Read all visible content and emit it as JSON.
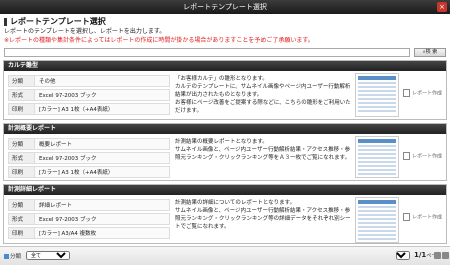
{
  "window": {
    "title": "レポートテンプレート選択",
    "close_glyph": "×"
  },
  "header": {
    "title": "レポートテンプレート選択",
    "description": "レポートのテンプレートを選択し、レポートを出力します。",
    "warning": "※レポートの種類や集計条件によってはレポートの作成に時間が掛かる場合がありますことを予めご了承願います。"
  },
  "search": {
    "placeholder": "",
    "button_label": "検 索"
  },
  "cards": [
    {
      "title": "カルテ雛型",
      "attrs": [
        {
          "key": "分類",
          "value": "その他"
        },
        {
          "key": "形式",
          "value": "Excel 97-2003 ブック"
        },
        {
          "key": "印刷",
          "value": "[カラー] A3 1枚（+A4表紙）"
        }
      ],
      "description": "「お客様カルテ」の雛形となります。\nカルテのテンプレートに、サムネイル画像やページ内ユーザー行動解析結果が出力されたものとなります。\nお客様にページ改善をご提案する際などに、こちらの雛形をご利用いただけます。",
      "make_label": "レポート作成"
    },
    {
      "title": "計測概要レポート",
      "attrs": [
        {
          "key": "分類",
          "value": "概要レポート"
        },
        {
          "key": "形式",
          "value": "Excel 97-2003 ブック"
        },
        {
          "key": "印刷",
          "value": "[カラー] A3 1枚（+A4表紙）"
        }
      ],
      "description": "計測結果の概要レポートとなります。\nサムネイル画像と、ページ内ユーザー行動解析結果・アクセス推移・参照元ランキング・クリックランキング等をＡ３一枚でご覧になれます。",
      "make_label": "レポート作成"
    },
    {
      "title": "計測詳細レポート",
      "attrs": [
        {
          "key": "分類",
          "value": "詳細レポート"
        },
        {
          "key": "形式",
          "value": "Excel 97-2003 ブック"
        },
        {
          "key": "印刷",
          "value": "[カラー] A3/A4 複数枚"
        }
      ],
      "description": "計測結果の詳細についてのレポートとなります。\nサムネイル画像と、ページ内ユーザー行動解析結果・アクセス推移・参照元ランキング・クリックランキング等の詳細データをそれぞれ別シートでご覧になれます。",
      "make_label": "レポート作成"
    }
  ],
  "footer": {
    "filter_label": "分類",
    "filter_value": "全て",
    "page_size": "5",
    "page_current": "1/1",
    "page_suffix": "ページ"
  }
}
